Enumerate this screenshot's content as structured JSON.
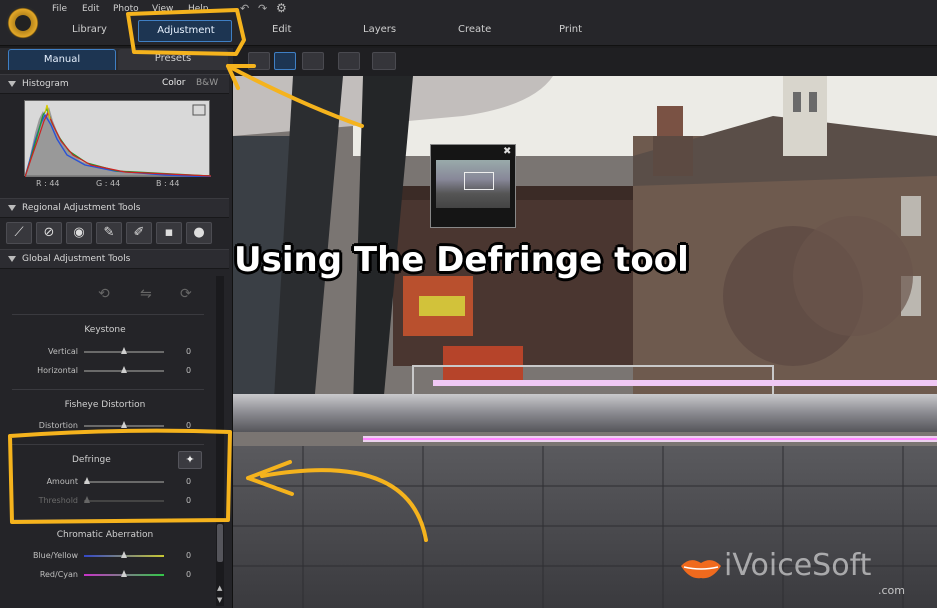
{
  "menu": {
    "items": [
      "File",
      "Edit",
      "Photo",
      "View",
      "Help"
    ]
  },
  "modes": {
    "library": "Library",
    "adjustment": "Adjustment",
    "edit": "Edit",
    "layers": "Layers",
    "create": "Create",
    "print": "Print"
  },
  "panel_tabs": {
    "manual": "Manual",
    "presets": "Presets"
  },
  "histogram": {
    "title": "Histogram",
    "color_toggle": "Color",
    "bw_toggle": "B&W",
    "r": "R : 44",
    "g": "G : 44",
    "b": "B : 44"
  },
  "regional": {
    "title": "Regional Adjustment Tools"
  },
  "global": {
    "title": "Global Adjustment Tools"
  },
  "keystone": {
    "title": "Keystone",
    "vertical_label": "Vertical",
    "vertical_value": "0",
    "horizontal_label": "Horizontal",
    "horizontal_value": "0"
  },
  "fisheye": {
    "title": "Fisheye Distortion",
    "distortion_label": "Distortion",
    "distortion_value": "0"
  },
  "defringe": {
    "title": "Defringe",
    "amount_label": "Amount",
    "amount_value": "0",
    "threshold_label": "Threshold",
    "threshold_value": "0"
  },
  "chromatic": {
    "title": "Chromatic Aberration",
    "blue_yellow_label": "Blue/Yellow",
    "blue_yellow_value": "0",
    "red_cyan_label": "Red/Cyan",
    "red_cyan_value": "0"
  },
  "overlay": {
    "title": "Using The Defringe tool"
  },
  "watermark": {
    "brand": "iVoiceSoft",
    "domain": ".com"
  },
  "colors": {
    "accent_blue": "#3f7fc4",
    "annotation_yellow": "#f5b31d",
    "brand_orange": "#f06a1d"
  }
}
